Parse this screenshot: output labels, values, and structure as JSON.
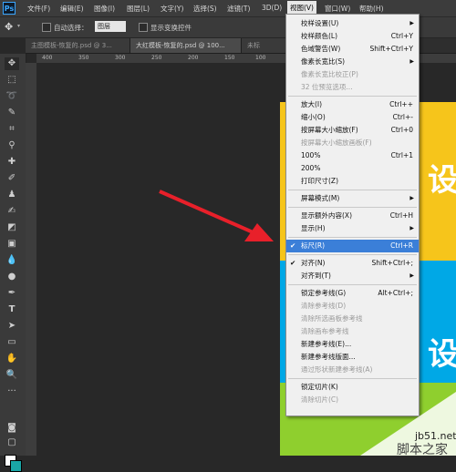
{
  "menubar": {
    "app_logo": "Ps",
    "items": [
      "文件(F)",
      "编辑(E)",
      "图像(I)",
      "图层(L)",
      "文字(Y)",
      "选择(S)",
      "滤镜(T)",
      "3D(D)",
      "视图(V)",
      "窗口(W)",
      "帮助(H)"
    ]
  },
  "options": {
    "auto_select_label": "自动选择：",
    "layer_select_value": "图层",
    "show_transform_label": "显示变换控件"
  },
  "tabs": [
    "主图模板-恢复的.psd @ 3...",
    "大红模板-恢复的.psd @ 100...",
    "未标"
  ],
  "ruler": [
    "400",
    "350",
    "300",
    "250",
    "200",
    "150",
    "100",
    "50",
    "0",
    "50"
  ],
  "canvas": {
    "glyph1": "设",
    "glyph2": "设"
  },
  "view_menu": {
    "items": [
      {
        "label": "校样设置(U)",
        "shortcut": "",
        "submenu": true,
        "disabled": false,
        "checked": false
      },
      {
        "label": "校样颜色(L)",
        "shortcut": "Ctrl+Y",
        "submenu": false,
        "disabled": false,
        "checked": false
      },
      {
        "label": "色域警告(W)",
        "shortcut": "Shift+Ctrl+Y",
        "submenu": false,
        "disabled": false,
        "checked": false
      },
      {
        "label": "像素长宽比(S)",
        "shortcut": "",
        "submenu": true,
        "disabled": false,
        "checked": false
      },
      {
        "label": "像素长宽比校正(P)",
        "shortcut": "",
        "submenu": false,
        "disabled": true,
        "checked": false
      },
      {
        "label": "32 位预览选项...",
        "shortcut": "",
        "submenu": false,
        "disabled": true,
        "checked": false
      },
      {
        "sep": true
      },
      {
        "label": "放大(I)",
        "shortcut": "Ctrl++",
        "submenu": false,
        "disabled": false,
        "checked": false
      },
      {
        "label": "缩小(O)",
        "shortcut": "Ctrl+-",
        "submenu": false,
        "disabled": false,
        "checked": false
      },
      {
        "label": "按屏幕大小缩放(F)",
        "shortcut": "Ctrl+0",
        "submenu": false,
        "disabled": false,
        "checked": false
      },
      {
        "label": "按屏幕大小缩放画板(F)",
        "shortcut": "",
        "submenu": false,
        "disabled": true,
        "checked": false
      },
      {
        "label": "100%",
        "shortcut": "Ctrl+1",
        "submenu": false,
        "disabled": false,
        "checked": false
      },
      {
        "label": "200%",
        "shortcut": "",
        "submenu": false,
        "disabled": false,
        "checked": false
      },
      {
        "label": "打印尺寸(Z)",
        "shortcut": "",
        "submenu": false,
        "disabled": false,
        "checked": false
      },
      {
        "sep": true
      },
      {
        "label": "屏幕模式(M)",
        "shortcut": "",
        "submenu": true,
        "disabled": false,
        "checked": false
      },
      {
        "sep": true
      },
      {
        "label": "显示额外内容(X)",
        "shortcut": "Ctrl+H",
        "submenu": false,
        "disabled": false,
        "checked": false
      },
      {
        "label": "显示(H)",
        "shortcut": "",
        "submenu": true,
        "disabled": false,
        "checked": false
      },
      {
        "sep": true
      },
      {
        "label": "标尺(R)",
        "shortcut": "Ctrl+R",
        "submenu": false,
        "disabled": false,
        "checked": true,
        "highlight": true
      },
      {
        "sep": true
      },
      {
        "label": "对齐(N)",
        "shortcut": "Shift+Ctrl+;",
        "submenu": false,
        "disabled": false,
        "checked": true
      },
      {
        "label": "对齐到(T)",
        "shortcut": "",
        "submenu": true,
        "disabled": false,
        "checked": false
      },
      {
        "sep": true
      },
      {
        "label": "锁定参考线(G)",
        "shortcut": "Alt+Ctrl+;",
        "submenu": false,
        "disabled": false,
        "checked": false
      },
      {
        "label": "清除参考线(D)",
        "shortcut": "",
        "submenu": false,
        "disabled": true,
        "checked": false
      },
      {
        "label": "清除所选画板参考线",
        "shortcut": "",
        "submenu": false,
        "disabled": true,
        "checked": false
      },
      {
        "label": "清除画布参考线",
        "shortcut": "",
        "submenu": false,
        "disabled": true,
        "checked": false
      },
      {
        "label": "新建参考线(E)...",
        "shortcut": "",
        "submenu": false,
        "disabled": false,
        "checked": false
      },
      {
        "label": "新建参考线版面...",
        "shortcut": "",
        "submenu": false,
        "disabled": false,
        "checked": false
      },
      {
        "label": "通过形状新建参考线(A)",
        "shortcut": "",
        "submenu": false,
        "disabled": true,
        "checked": false
      },
      {
        "sep": true
      },
      {
        "label": "锁定切片(K)",
        "shortcut": "",
        "submenu": false,
        "disabled": false,
        "checked": false
      },
      {
        "label": "清除切片(C)",
        "shortcut": "",
        "submenu": false,
        "disabled": true,
        "checked": false
      }
    ]
  },
  "watermark": {
    "line1": "jb51.net",
    "line2": "脚本之家"
  },
  "colors": {
    "accent": "#3b7fd8",
    "arrow": "#e8202a",
    "yellow": "#f6c51b",
    "blue": "#00a8e6",
    "green": "#8fcf2e"
  }
}
